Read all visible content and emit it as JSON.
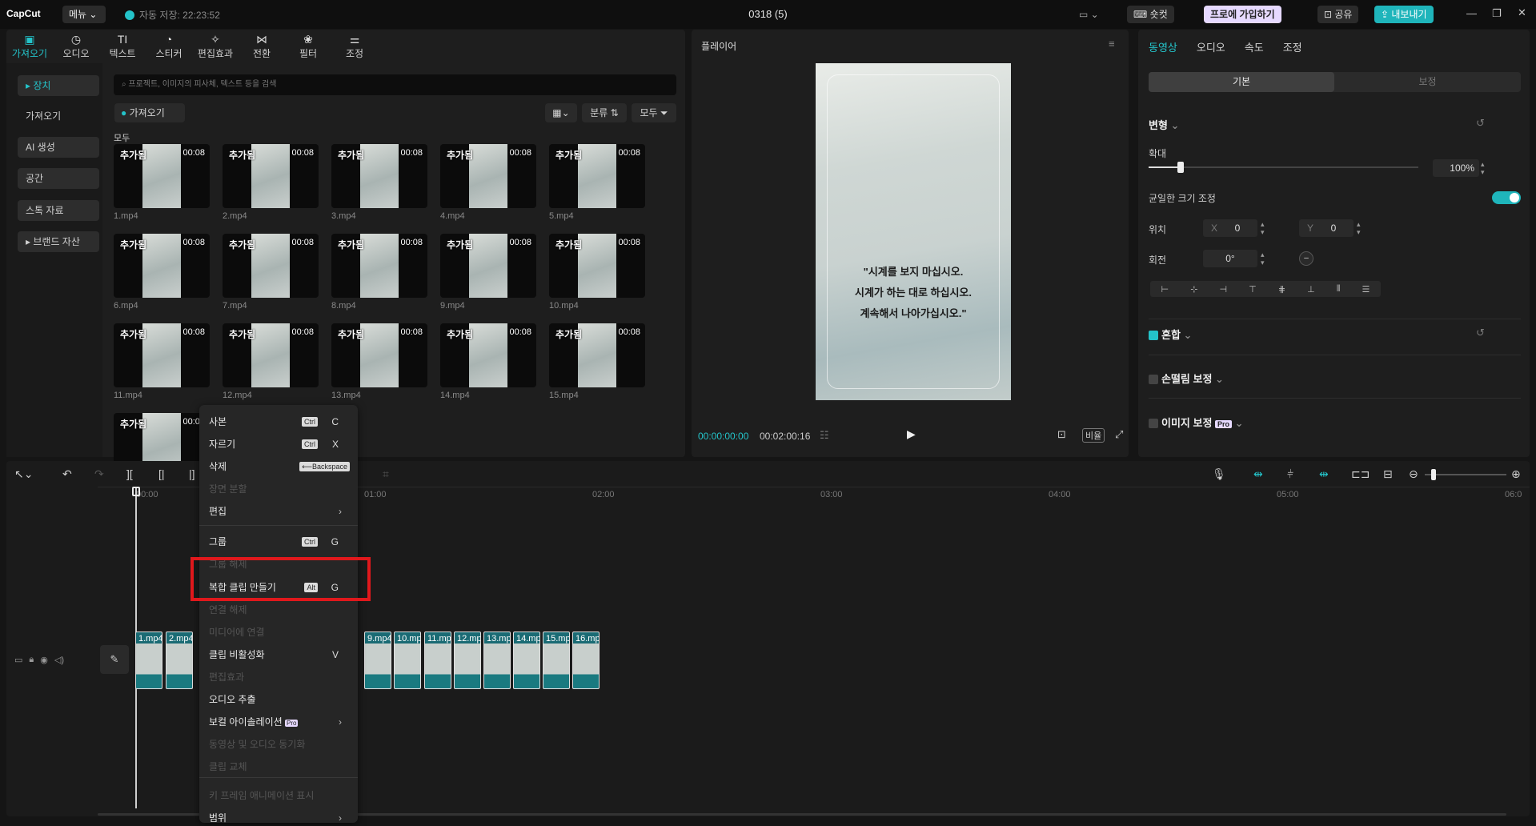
{
  "titlebar": {
    "logo": "CapCut",
    "menu": "메뉴 ⌄",
    "autosave": "자동 저장: 22:23:52",
    "doc_title": "0318 (5)",
    "shortcut": "숏컷",
    "pro": "프로에 가입하기",
    "share": "공유",
    "export": "내보내기"
  },
  "media_tabs": [
    {
      "label": "가져오기",
      "icon": "import-icon",
      "glyph": "▣"
    },
    {
      "label": "오디오",
      "icon": "audio-icon",
      "glyph": "◷"
    },
    {
      "label": "텍스트",
      "icon": "text-icon",
      "glyph": "TI"
    },
    {
      "label": "스티커",
      "icon": "sticker-icon",
      "glyph": "◔"
    },
    {
      "label": "편집효과",
      "icon": "effects-icon",
      "glyph": "✧"
    },
    {
      "label": "전환",
      "icon": "transition-icon",
      "glyph": "⋈"
    },
    {
      "label": "필터",
      "icon": "filter-icon",
      "glyph": "❀"
    },
    {
      "label": "조정",
      "icon": "adjust-icon",
      "glyph": "⚌"
    }
  ],
  "sidebar": {
    "items": [
      "▸ 장치",
      "가져오기",
      "AI 생성",
      "공간",
      "스톡 자료",
      "▸ 브랜드 자산"
    ]
  },
  "media": {
    "search_placeholder": "프로젝트, 이미지의 피사체, 텍스트 등을 검색",
    "import_btn": "가져오기",
    "sort_btn": "분류",
    "filter_btn": "모두",
    "all_label": "모두",
    "added_tag": "추가됨",
    "files": [
      {
        "name": "1.mp4",
        "dur": "00:08"
      },
      {
        "name": "2.mp4",
        "dur": "00:08"
      },
      {
        "name": "3.mp4",
        "dur": "00:08"
      },
      {
        "name": "4.mp4",
        "dur": "00:08"
      },
      {
        "name": "5.mp4",
        "dur": "00:08"
      },
      {
        "name": "6.mp4",
        "dur": "00:08"
      },
      {
        "name": "7.mp4",
        "dur": "00:08"
      },
      {
        "name": "8.mp4",
        "dur": "00:08"
      },
      {
        "name": "9.mp4",
        "dur": "00:08"
      },
      {
        "name": "10.mp4",
        "dur": "00:08"
      },
      {
        "name": "11.mp4",
        "dur": "00:08"
      },
      {
        "name": "12.mp4",
        "dur": "00:08"
      },
      {
        "name": "13.mp4",
        "dur": "00:08"
      },
      {
        "name": "14.mp4",
        "dur": "00:08"
      },
      {
        "name": "15.mp4",
        "dur": "00:08"
      },
      {
        "name": "",
        "dur": "00:08"
      }
    ]
  },
  "player": {
    "title": "플레이어",
    "quote_lines": [
      "\"시계를 보지 마십시오.",
      "시계가 하는 대로 하십시오.",
      "계속해서 나아가십시오.\""
    ],
    "current_time": "00:00:00:00",
    "total_time": "00:02:00:16",
    "ratio_btn": "비율"
  },
  "right_panel": {
    "tabs": [
      "동영상",
      "오디오",
      "속도",
      "조정"
    ],
    "sub_tabs": [
      "기본",
      "보정"
    ],
    "transform": "변형",
    "scale_label": "확대",
    "scale_value": "100%",
    "scale_level": 0.12,
    "uniform_label": "균일한 크기 조정",
    "position_label": "위치",
    "pos_x_label": "X",
    "pos_x": "0",
    "pos_y_label": "Y",
    "pos_y": "0",
    "rotation_label": "회전",
    "rotation": "0°",
    "blend_label": "혼합",
    "stabilize_label": "손떨림 보정",
    "image_adjust_label": "이미지 보정",
    "pro_badge": "Pro"
  },
  "timeline": {
    "ruler": [
      "00:00",
      "01:00",
      "02:00",
      "03:00",
      "04:00",
      "05:00",
      "06:0"
    ],
    "clips": [
      "1.mp4",
      "2.mp4",
      "9.mp4",
      "10.mp4",
      "11.mp4",
      "12.mp4",
      "13.mp4",
      "14.mp4",
      "15.mp4",
      "16.mp4"
    ]
  },
  "context_menu": {
    "items": [
      {
        "label": "사본",
        "kb": "Ctrl",
        "key": "C",
        "enabled": true
      },
      {
        "label": "자르기",
        "kb": "Ctrl",
        "key": "X",
        "enabled": true
      },
      {
        "label": "삭제",
        "kb": "⟵Backspace",
        "key": "",
        "enabled": true
      },
      {
        "label": "장면 분할",
        "kb": "",
        "key": "",
        "enabled": false
      },
      {
        "label": "편집",
        "kb": "",
        "key": "",
        "enabled": true,
        "submenu": true
      },
      {
        "label": "그룹",
        "kb": "Ctrl",
        "key": "G",
        "enabled": true
      },
      {
        "label": "그룹 해제",
        "kb": "",
        "key": "",
        "enabled": false
      },
      {
        "label": "복합 클립 만들기",
        "kb": "Alt",
        "key": "G",
        "enabled": true,
        "highlighted": true
      },
      {
        "label": "연결 해제",
        "kb": "",
        "key": "",
        "enabled": false
      },
      {
        "label": "미디어에 연결",
        "kb": "",
        "key": "",
        "enabled": false
      },
      {
        "label": "클립 비활성화",
        "kb": "",
        "key": "V",
        "enabled": true
      },
      {
        "label": "편집효과",
        "kb": "",
        "key": "",
        "enabled": false
      },
      {
        "label": "오디오 추출",
        "kb": "",
        "key": "",
        "enabled": true
      },
      {
        "label": "보컬 아이솔레이션",
        "kb": "",
        "key": "",
        "enabled": true,
        "pro": true,
        "submenu": true
      },
      {
        "label": "동영상 및 오디오 동기화",
        "kb": "",
        "key": "",
        "enabled": false
      },
      {
        "label": "클립 교체",
        "kb": "",
        "key": "",
        "enabled": false
      },
      {
        "label": "키 프레임 애니메이션 표시",
        "kb": "",
        "key": "",
        "enabled": false
      },
      {
        "label": "범위",
        "kb": "",
        "key": "",
        "enabled": true,
        "submenu": true
      }
    ]
  },
  "colors": {
    "accent": "#24c3c9",
    "highlight_box": "#e0181c",
    "bg": "#151515",
    "panel": "#1e1e1e"
  }
}
